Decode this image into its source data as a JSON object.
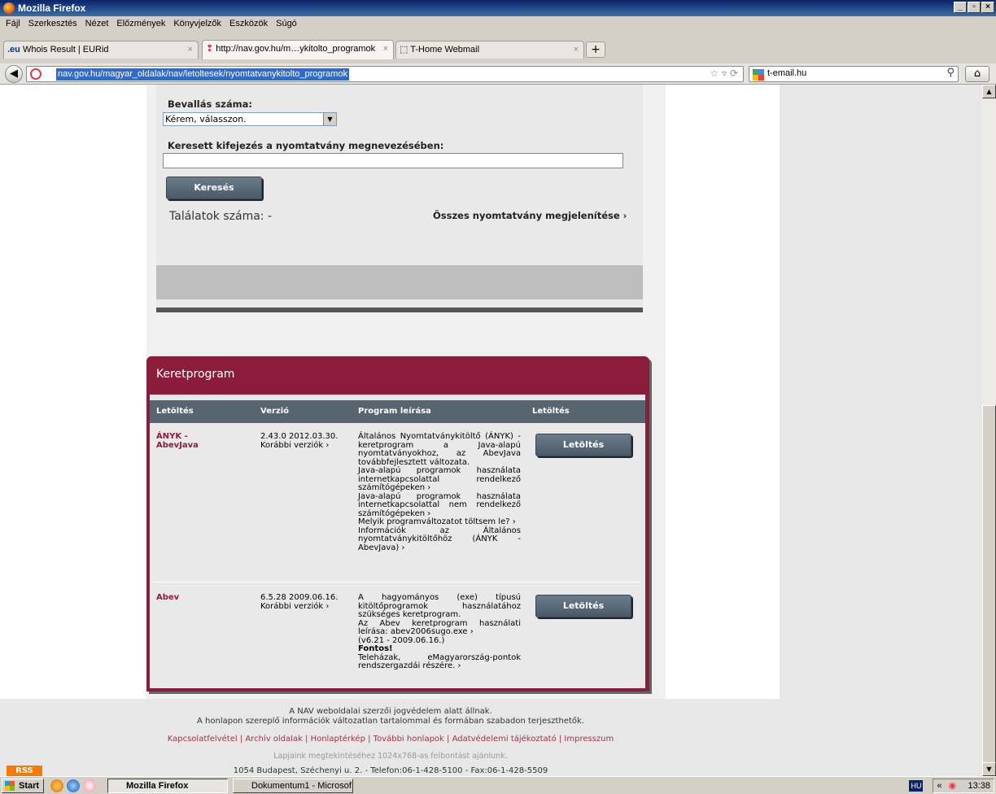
{
  "window": {
    "title": "Mozilla Firefox"
  },
  "menu": [
    "Fájl",
    "Szerkesztés",
    "Nézet",
    "Előzmények",
    "Könyvjelzők",
    "Eszközök",
    "Súgó"
  ],
  "tabs": [
    {
      "label": "Whois Result | EURid",
      "badge": ".eu"
    },
    {
      "label": "http://nav.gov.hu/m…ykitolto_programok"
    },
    {
      "label": "T-Home Webmail"
    }
  ],
  "nav": {
    "url": "nav.gov.hu/magyar_oldalak/nav/letoltesek/nyomtatvanykitolto_programok",
    "search_engine": "t-email.hu"
  },
  "search": {
    "bevallas_label": "Bevallás száma:",
    "select_value": "Kérem, válasszon.",
    "keyword_label": "Keresett kifejezés a nyomtatvány megnevezésében:",
    "keyword_value": "",
    "button": "Keresés",
    "count_text": "Találatok száma: -",
    "show_all": "Összes nyomtatvány megjelenítése ›"
  },
  "keret": {
    "title": "Keretprogram",
    "columns": [
      "Letöltés",
      "Verzió",
      "Program leírása",
      "Letöltés"
    ],
    "rows": [
      {
        "name1": "ÁNYK -",
        "name2": "AbevJava",
        "version": "2.43.0 2012.03.30.",
        "older": "Korábbi verziók ›",
        "desc": [
          "Általános Nyomtatványkitöltő (ÁNYK) - keretprogram a Java-alapú nyomtatványokhoz, az AbevJava továbbfejlesztett változata.",
          "Java-alapú programok használata internetkapcsolattal rendelkező számítógépeken ›",
          "Java-alapú programok használata internetkapcsolattal nem rendelkező számítógépeken ›",
          "Melyik programváltozatot töltsem le? ›",
          "Információk az Általános nyomtatványkitöltőhöz (ÁNYK - AbevJava) ›"
        ],
        "button": "Letöltés"
      },
      {
        "name1": "Abev",
        "name2": "",
        "version": "6.5.28 2009.06.16.",
        "older": "Korábbi verziók ›",
        "desc": [
          "A hagyományos (exe) típusú kitöltőprogramok használatához szükséges keretprogram.",
          "Az Abev keretprogram használati leírása: abev2006sugo.exe ›",
          "(v6.21 - 2009.06.16.)",
          "Fontos!",
          "Teleházak, eMagyarország-pontok rendszergazdái részére. ›"
        ],
        "button": "Letöltés"
      }
    ]
  },
  "footer": {
    "l1": "A NAV weboldalai szerzői jogvédelem alatt állnak.",
    "l2": "A honlapon szereplő információk változatlan tartalommal és formában szabadon terjeszthetők.",
    "links": "Kapcsolatfelvétel | Archív oldalak | Honlaptérkép | További honlapok | Adatvédelemi tájékoztató | Impresszum",
    "l3": "Lapjaink megtekintéséhez 1024x768-as felbontást ajánlunk.",
    "l4": "1054 Budapest, Széchenyi u. 2. - Telefon:06-1-428-5100 - Fax:06-1-428-5509",
    "rss": "RSS"
  },
  "taskbar": {
    "start": "Start",
    "items": [
      "Mozilla Firefox",
      "Dokumentum1 - Microsof..."
    ],
    "lang": "HU",
    "clock": "13:38"
  }
}
